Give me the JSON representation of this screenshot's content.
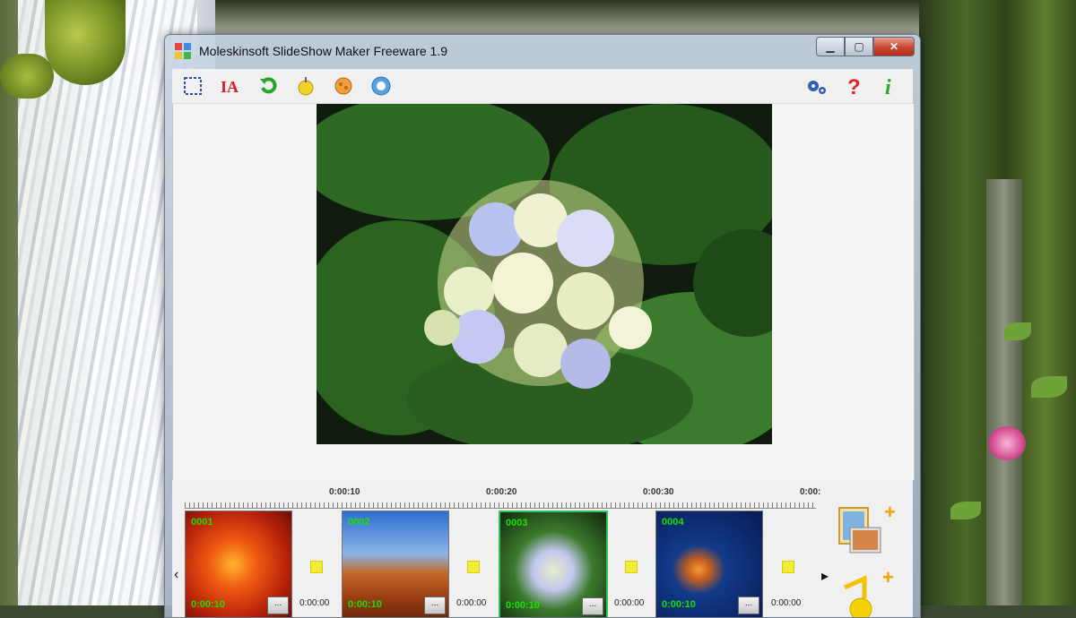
{
  "window": {
    "title": "Moleskinsoft SlideShow Maker Freeware 1.9",
    "controls": {
      "minimize": "▁",
      "maximize": "▢",
      "close": "✕"
    }
  },
  "toolbar": {
    "left_icons": [
      "select-area-icon",
      "add-text-icon",
      "rotate-icon",
      "add-music-icon",
      "effects-icon",
      "info-icon"
    ],
    "right_icons": [
      "settings-icon",
      "help-icon",
      "about-icon"
    ]
  },
  "timeline": {
    "ruler_labels": [
      "0:00:10",
      "0:00:20",
      "0:00:30",
      "0:00:"
    ],
    "slides": [
      {
        "number": "0001",
        "duration": "0:00:10",
        "more_label": "...",
        "subject": "red flower"
      },
      {
        "number": "0002",
        "duration": "0:00:10",
        "more_label": "...",
        "subject": "desert rock"
      },
      {
        "number": "0003",
        "duration": "0:00:10",
        "more_label": "...",
        "subject": "hydrangea"
      },
      {
        "number": "0004",
        "duration": "0:00:10",
        "more_label": "...",
        "subject": "jellyfish"
      }
    ],
    "transitions": [
      "0:00:00",
      "0:00:00",
      "0:00:00",
      "0:00:00"
    ],
    "selected_slide": "0003"
  },
  "side_actions": {
    "add_image_icon": "add-image-icon",
    "add_music_icon": "add-music-icon",
    "plus": "+"
  },
  "colors": {
    "accent": "#1be000",
    "selected_border": "#34c15a",
    "transition_marker": "#f2ec34"
  }
}
